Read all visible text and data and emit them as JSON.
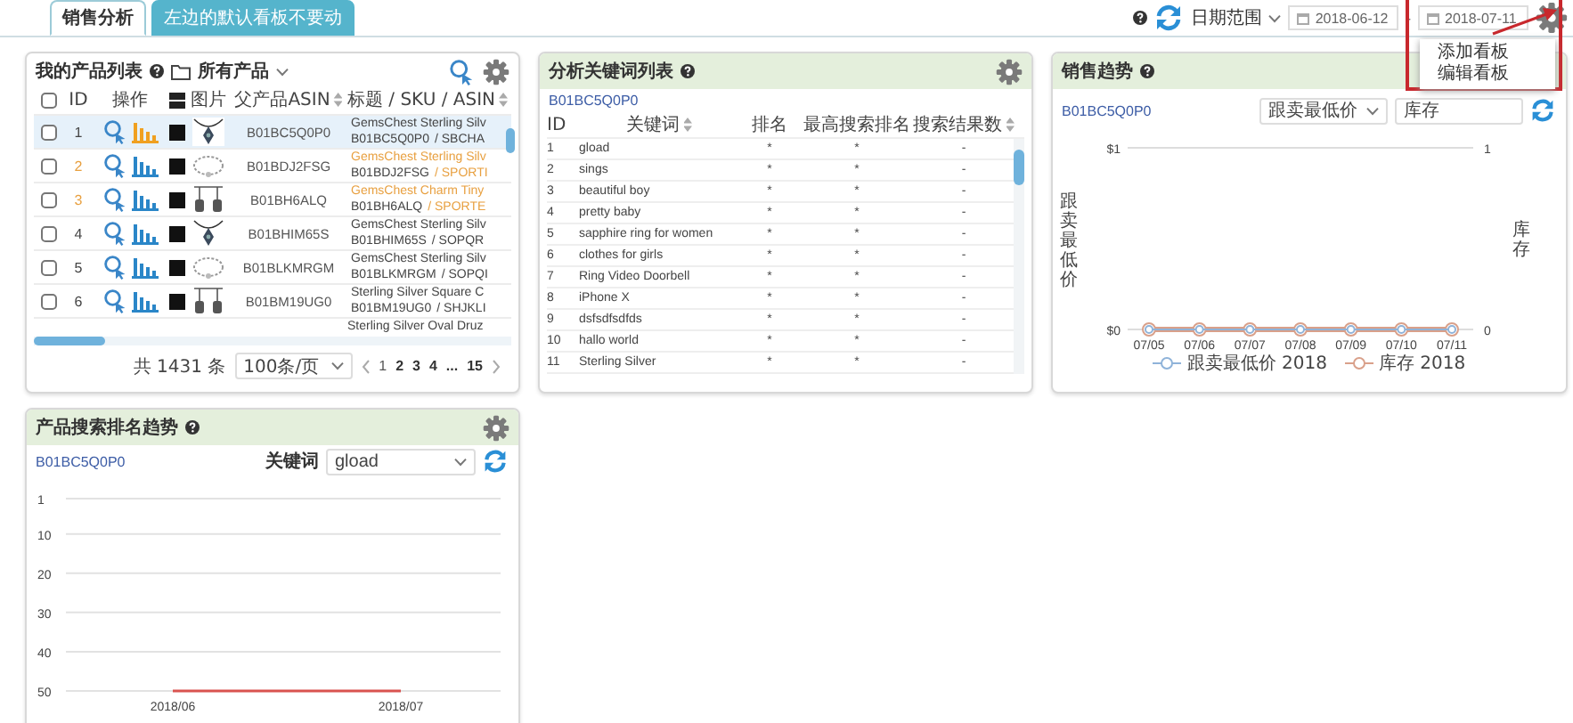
{
  "top_tabs": [
    {
      "label": "销售分析",
      "selected": true
    },
    {
      "label": "左边的默认看板不要动",
      "selected": false
    }
  ],
  "toolbar": {
    "date_range_label": "日期范围",
    "start_date": "2018-06-12",
    "separator": "-",
    "end_date": "2018-07-11"
  },
  "board_menu": {
    "open": true,
    "items": [
      "添加看板",
      "编辑看板"
    ]
  },
  "products": {
    "title": "我的产品列表",
    "filter": "所有产品",
    "select_all_checked": false,
    "columns": [
      {
        "label": "ID",
        "sortable": false
      },
      {
        "label": "操作",
        "sortable": false
      },
      {
        "label": "图片",
        "sortable": false
      },
      {
        "label": "父产品ASIN",
        "sortable": true
      },
      {
        "label": "标题 / SKU / ASIN",
        "sortable": true
      }
    ],
    "rows": [
      {
        "id": "1",
        "parent_asin": "B01BC5Q0P0",
        "title": "GemsChest Sterling Silv",
        "asin": "B01BC5Q0P0",
        "sku": "/ SBCHA",
        "checked": false,
        "selected": true,
        "highlight": false
      },
      {
        "id": "2",
        "parent_asin": "B01BDJ2FSG",
        "title": "GemsChest Sterling Silv",
        "asin": "B01BDJ2FSG",
        "sku": "/ SPORTI",
        "checked": false,
        "selected": false,
        "highlight": true
      },
      {
        "id": "3",
        "parent_asin": "B01BH6ALQ",
        "title": "GemsChest Charm Tiny",
        "asin": "B01BH6ALQ",
        "sku": "/ SPORTE",
        "checked": false,
        "selected": false,
        "highlight": true
      },
      {
        "id": "4",
        "parent_asin": "B01BHIM65S",
        "title": "GemsChest Sterling Silv",
        "asin": "B01BHIM65S",
        "sku": "/ SOPQR",
        "checked": false,
        "selected": false,
        "highlight": false
      },
      {
        "id": "5",
        "parent_asin": "B01BLKMRGM",
        "title": "GemsChest Sterling Silv",
        "asin": "B01BLKMRGM",
        "sku": "/ SOPQI",
        "checked": false,
        "selected": false,
        "highlight": false
      },
      {
        "id": "6",
        "parent_asin": "B01BM19UG0",
        "title": "Sterling Silver Square C",
        "asin": "B01BM19UG0",
        "sku": "/ SHJKLI",
        "checked": false,
        "selected": false,
        "highlight": false
      }
    ],
    "cut_row": {
      "title": "Sterling Silver Oval Druz"
    },
    "total": "共 1431 条",
    "page_size": "100条/页",
    "pages": [
      {
        "label": "1",
        "selected": true
      },
      {
        "label": "2",
        "selected": false
      },
      {
        "label": "3",
        "selected": false
      },
      {
        "label": "4",
        "selected": false
      },
      {
        "label": "...",
        "selected": false
      },
      {
        "label": "15",
        "selected": false
      }
    ]
  },
  "keywords": {
    "title": "分析关键词列表",
    "asin": "B01BC5Q0P0",
    "columns": [
      {
        "label": "ID",
        "sortable": false
      },
      {
        "label": "关键词",
        "sortable": true
      },
      {
        "label": "排名",
        "sortable": false
      },
      {
        "label": "最高搜索排名",
        "sortable": false
      },
      {
        "label": "搜索结果数",
        "sortable": true
      }
    ],
    "rows": [
      {
        "id": "1",
        "keyword": "gload",
        "rank": "*",
        "best_rank": "*",
        "results": "-"
      },
      {
        "id": "2",
        "keyword": "sings",
        "rank": "*",
        "best_rank": "*",
        "results": "-"
      },
      {
        "id": "3",
        "keyword": "beautiful boy",
        "rank": "*",
        "best_rank": "*",
        "results": "-"
      },
      {
        "id": "4",
        "keyword": "pretty baby",
        "rank": "*",
        "best_rank": "*",
        "results": "-"
      },
      {
        "id": "5",
        "keyword": "sapphire ring for women",
        "rank": "*",
        "best_rank": "*",
        "results": "-"
      },
      {
        "id": "6",
        "keyword": "clothes for girls",
        "rank": "*",
        "best_rank": "*",
        "results": "-"
      },
      {
        "id": "7",
        "keyword": "Ring Video Doorbell",
        "rank": "*",
        "best_rank": "*",
        "results": "-"
      },
      {
        "id": "8",
        "keyword": "iPhone X",
        "rank": "*",
        "best_rank": "*",
        "results": "-"
      },
      {
        "id": "9",
        "keyword": "dsfsdfsdfds",
        "rank": "*",
        "best_rank": "*",
        "results": "-"
      },
      {
        "id": "10",
        "keyword": "hallo world",
        "rank": "*",
        "best_rank": "*",
        "results": "-"
      },
      {
        "id": "11",
        "keyword": "Sterling Silver",
        "rank": "*",
        "best_rank": "*",
        "results": "-"
      }
    ]
  },
  "sales_trend": {
    "title": "销售趋势",
    "asin": "B01BC5Q0P0",
    "metric_select": "跟卖最低价",
    "metric2_select": "库存",
    "chart_data": {
      "type": "line",
      "ylabel": "跟卖最低价",
      "categories": [
        "07/05",
        "07/06",
        "07/07",
        "07/08",
        "07/09",
        "07/10",
        "07/11"
      ],
      "series": [
        {
          "name": "跟卖最低价 2018",
          "color": "#8fb3d9",
          "marker": "circle",
          "values": [
            0,
            0,
            0,
            0,
            0,
            0,
            0
          ]
        },
        {
          "name": "库存 2018",
          "color": "#d9a08a",
          "marker": "circle",
          "values": [
            0,
            0,
            0,
            0,
            0,
            0,
            0
          ]
        }
      ],
      "ylim": [
        0,
        1
      ],
      "grid": true,
      "yticks": [
        {
          "value": 0,
          "label": "$0"
        },
        {
          "value": 1,
          "label": "$1"
        }
      ]
    },
    "right_axis": {
      "label": "库存",
      "ticks": [
        "1",
        "0"
      ]
    }
  },
  "rank_trend": {
    "title": "产品搜索排名趋势",
    "asin": "B01BC5Q0P0",
    "keyword_label": "关键词",
    "keyword": "gload",
    "chart_data": {
      "type": "line",
      "categories": [
        "2018/06",
        "2018/07"
      ],
      "series": [
        {
          "color": "#d9534f",
          "values": [
            50,
            50
          ]
        }
      ],
      "ylim": [
        50,
        1
      ],
      "grid": true,
      "yticks": [
        1,
        10,
        20,
        30,
        40,
        50
      ]
    }
  }
}
